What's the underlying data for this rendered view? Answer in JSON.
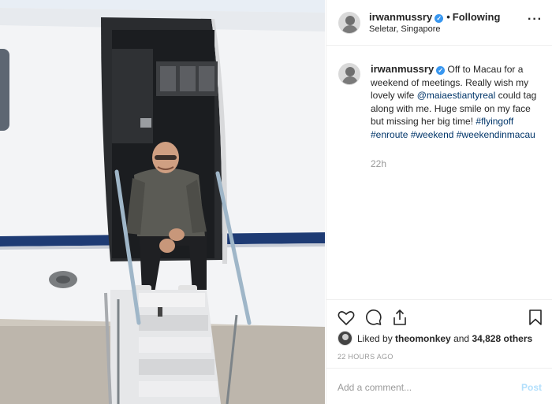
{
  "header": {
    "username": "irwanmussry",
    "separator": "•",
    "follow_status": "Following",
    "location": "Seletar, Singapore",
    "more_label": "···"
  },
  "caption": {
    "username": "irwanmussry",
    "text_part1": "Off to Macau for a weekend of meetings. Really wish my lovely wife",
    "mention": "@maiaestiantyreal",
    "text_part2": "could tag along with me. Huge smile on my face but missing her big time!",
    "hashtags": "#flyingoff #enroute #weekend #weekendinmacau",
    "time_ago": "22h"
  },
  "actions": {
    "like_icon": "heart-icon",
    "comment_icon": "comment-icon",
    "share_icon": "share-icon",
    "save_icon": "bookmark-icon"
  },
  "likes": {
    "prefix": "Liked by",
    "user": "theomonkey",
    "connector": "and",
    "count": "34,828 others"
  },
  "timestamp": "22 HOURS AGO",
  "comment": {
    "placeholder": "Add a comment...",
    "post_label": "Post"
  },
  "colors": {
    "verified": "#3897f0",
    "link": "#003569",
    "muted": "#999999",
    "post_disabled": "#b2dffc"
  }
}
